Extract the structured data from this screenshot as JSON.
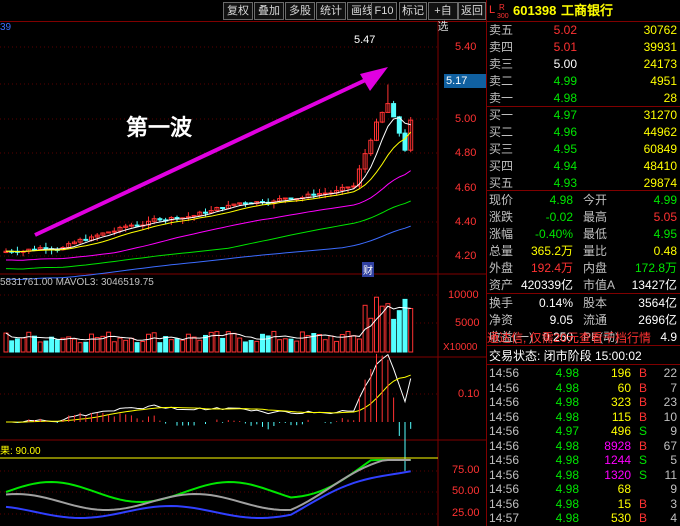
{
  "toolbar": {
    "buttons": [
      "复权",
      "叠加",
      "多股",
      "统计",
      "画线",
      "F10",
      "标记",
      "+自选",
      "返回"
    ]
  },
  "chart": {
    "corner_num": "39",
    "price_axis": [
      "5.40",
      "5.20",
      "5.00",
      "4.80",
      "4.60",
      "4.40",
      "4.20"
    ],
    "current_price_tag": "5.17",
    "high_label": "5.47",
    "annotation": "第一波",
    "cai_label": "财",
    "vol_legend": "5831761.00 MAVOL3: 3046519.75",
    "vol_axis": [
      "10000",
      "5000"
    ],
    "vol_unit": "X10000",
    "macd_axis": [
      "0.10"
    ],
    "kdj_legend": "果: 90.00",
    "kdj_axis": [
      "75.00",
      "50.00",
      "25.00"
    ],
    "colors": {
      "up": "#ff3232",
      "down": "#54ffff",
      "ma5": "#ffffff",
      "ma10": "#ffff00",
      "ma20": "#ff00ff",
      "ma60": "#00e600",
      "arrow": "#e000e0"
    }
  },
  "panel": {
    "header": {
      "market_l": "L",
      "market_r": "R",
      "market_num": "300",
      "code": "601398",
      "name": "工商银行"
    },
    "sells": [
      {
        "label": "卖五",
        "price": "5.02",
        "vol": "30762",
        "cls": "red"
      },
      {
        "label": "卖四",
        "price": "5.01",
        "vol": "39931",
        "cls": "red"
      },
      {
        "label": "卖三",
        "price": "5.00",
        "vol": "24173",
        "cls": "white"
      },
      {
        "label": "卖二",
        "price": "4.99",
        "vol": "4951",
        "cls": "green"
      },
      {
        "label": "卖一",
        "price": "4.98",
        "vol": "28",
        "cls": "green"
      }
    ],
    "buys": [
      {
        "label": "买一",
        "price": "4.97",
        "vol": "31270",
        "cls": "green"
      },
      {
        "label": "买二",
        "price": "4.96",
        "vol": "44962",
        "cls": "green"
      },
      {
        "label": "买三",
        "price": "4.95",
        "vol": "60849",
        "cls": "green"
      },
      {
        "label": "买四",
        "price": "4.94",
        "vol": "48410",
        "cls": "green"
      },
      {
        "label": "买五",
        "price": "4.93",
        "vol": "29874",
        "cls": "green"
      }
    ],
    "quote": [
      {
        "l1": "现价",
        "v1": "4.98",
        "c1": "green",
        "l2": "今开",
        "v2": "4.99",
        "c2": "green"
      },
      {
        "l1": "涨跌",
        "v1": "-0.02",
        "c1": "green",
        "l2": "最高",
        "v2": "5.05",
        "c2": "red"
      },
      {
        "l1": "涨幅",
        "v1": "-0.40%",
        "c1": "green",
        "l2": "最低",
        "v2": "4.95",
        "c2": "green"
      },
      {
        "l1": "总量",
        "v1": "365.2万",
        "c1": "yellow",
        "l2": "量比",
        "v2": "0.48",
        "c2": "yellow"
      },
      {
        "l1": "外盘",
        "v1": "192.4万",
        "c1": "red",
        "l2": "内盘",
        "v2": "172.8万",
        "c2": "green"
      },
      {
        "l1": "资产",
        "v1": "420339亿",
        "c1": "white",
        "l2": "市值A",
        "v2": "13427亿",
        "c2": "white"
      }
    ],
    "fund": [
      {
        "l1": "换手",
        "v1": "0.14%",
        "l2": "股本",
        "v2": "3564亿"
      },
      {
        "l1": "净资",
        "v1": "9.05",
        "l2": "流通",
        "v2": "2696亿"
      },
      {
        "l1": "收益(一)",
        "v1": "0.250",
        "l2": "PE(动)",
        "v2": "4.9"
      }
    ],
    "promo": "通达信, 仅需20元查看千档行情",
    "trade_status": "交易状态: 闭市阶段 15:00:02",
    "trades": [
      {
        "time": "14:56",
        "price": "4.98",
        "vol": "196",
        "bs": "B",
        "n": "22"
      },
      {
        "time": "14:56",
        "price": "4.98",
        "vol": "60",
        "bs": "B",
        "n": "7"
      },
      {
        "time": "14:56",
        "price": "4.98",
        "vol": "323",
        "bs": "B",
        "n": "23"
      },
      {
        "time": "14:56",
        "price": "4.98",
        "vol": "115",
        "bs": "B",
        "n": "10"
      },
      {
        "time": "14:56",
        "price": "4.97",
        "vol": "496",
        "bs": "S",
        "n": "9"
      },
      {
        "time": "14:56",
        "price": "4.98",
        "vol": "8928",
        "bs": "B",
        "n": "67"
      },
      {
        "time": "14:56",
        "price": "4.98",
        "vol": "1244",
        "bs": "S",
        "n": "5"
      },
      {
        "time": "14:56",
        "price": "4.98",
        "vol": "1320",
        "bs": "S",
        "n": "11"
      },
      {
        "time": "14:56",
        "price": "4.98",
        "vol": "68",
        "bs": "",
        "n": "9"
      },
      {
        "time": "14:56",
        "price": "4.98",
        "vol": "15",
        "bs": "B",
        "n": "3"
      },
      {
        "time": "14:57",
        "price": "4.98",
        "vol": "530",
        "bs": "B",
        "n": "4"
      }
    ]
  }
}
